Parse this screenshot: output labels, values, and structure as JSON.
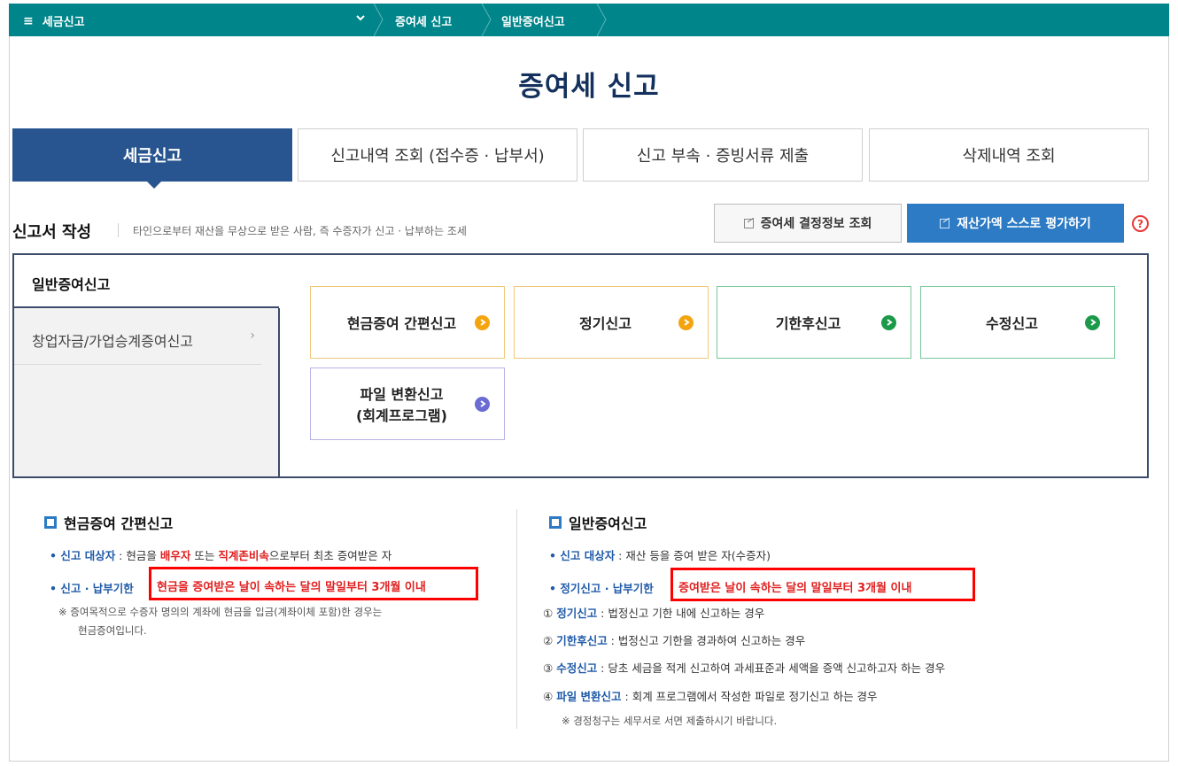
{
  "topbar": {
    "menu_label": "세금신고",
    "breadcrumb": [
      "증여세 신고",
      "일반증여신고"
    ]
  },
  "page_title": "증여세 신고",
  "tabs": [
    {
      "label": "세금신고",
      "active": true
    },
    {
      "label": "신고내역 조회 (접수증 · 납부서)",
      "active": false
    },
    {
      "label": "신고 부속 · 증빙서류 제출",
      "active": false
    },
    {
      "label": "삭제내역 조회",
      "active": false
    }
  ],
  "section": {
    "title": "신고서 작성",
    "desc": "타인으로부터 재산을 무상으로 받은 사람, 즉 수증자가 신고 · 납부하는 조세",
    "btn_info": "증여세 결정정보 조회",
    "btn_evaluate": "재산가액 스스로 평가하기",
    "help": "?"
  },
  "left_menu": {
    "active": "일반증여신고",
    "item": "창업자금/가업승계증여신고",
    "item_arrow": "›"
  },
  "cards": [
    {
      "label": "현금증여 간편신고",
      "color": "orange"
    },
    {
      "label": "정기신고",
      "color": "orange"
    },
    {
      "label": "기한후신고",
      "color": "green"
    },
    {
      "label": "수정신고",
      "color": "green"
    },
    {
      "label_1": "파일 변환신고",
      "label_2": "(회계프로그램)",
      "color": "purple"
    }
  ],
  "info_left": {
    "title": "현금증여 간편신고",
    "target_label": "• 신고 대상자",
    "target_pre": " : 현금을 ",
    "target_red1": "배우자",
    "target_mid": " 또는 ",
    "target_red2": "직계존비속",
    "target_post": "으로부터 최초 증여받은 자",
    "deadline_label": "• 신고 · 납부기한",
    "deadline_value": "현금을 증여받은 날이 속하는 달의 말일부터 3개월 이내",
    "note_1": "※ 증여목적으로 수증자 명의의 계좌에 현금을 입금(계좌이체 포함)한 경우는",
    "note_2": "현금증여입니다."
  },
  "info_right": {
    "title": "일반증여신고",
    "target_label": "• 신고 대상자",
    "target_text": " : 재산 등을 증여 받은 자(수증자)",
    "deadline_label": "• 정기신고 · 납부기한",
    "deadline_value": "증여받은 날이 속하는 달의 말일부터 3개월 이내",
    "items": [
      {
        "num": "① ",
        "label": "정기신고",
        "text": " : 법정신고 기한 내에 신고하는 경우"
      },
      {
        "num": "② ",
        "label": "기한후신고",
        "text": " : 법정신고 기한을 경과하여 신고하는 경우"
      },
      {
        "num": "③ ",
        "label": "수정신고",
        "text": " : 당초 세금을 적게 신고하여 과세표준과 세액을 증액 신고하고자 하는 경우"
      },
      {
        "num": "④ ",
        "label": "파일 변환신고",
        "text": " : 회계 프로그램에서 작성한 파일로 정기신고 하는 경우"
      }
    ],
    "note": "※ 경정청구는 세무서로 서면 제출하시기 바랍니다."
  },
  "colors": {
    "topbar": "#00858a",
    "tab_active": "#28558f",
    "title": "#13315c",
    "button_blue": "#2d7bc5",
    "highlight_red": "#ff0000",
    "orange": "#f4a40f",
    "green": "#1c9a4a",
    "purple": "#6a6bd3"
  }
}
